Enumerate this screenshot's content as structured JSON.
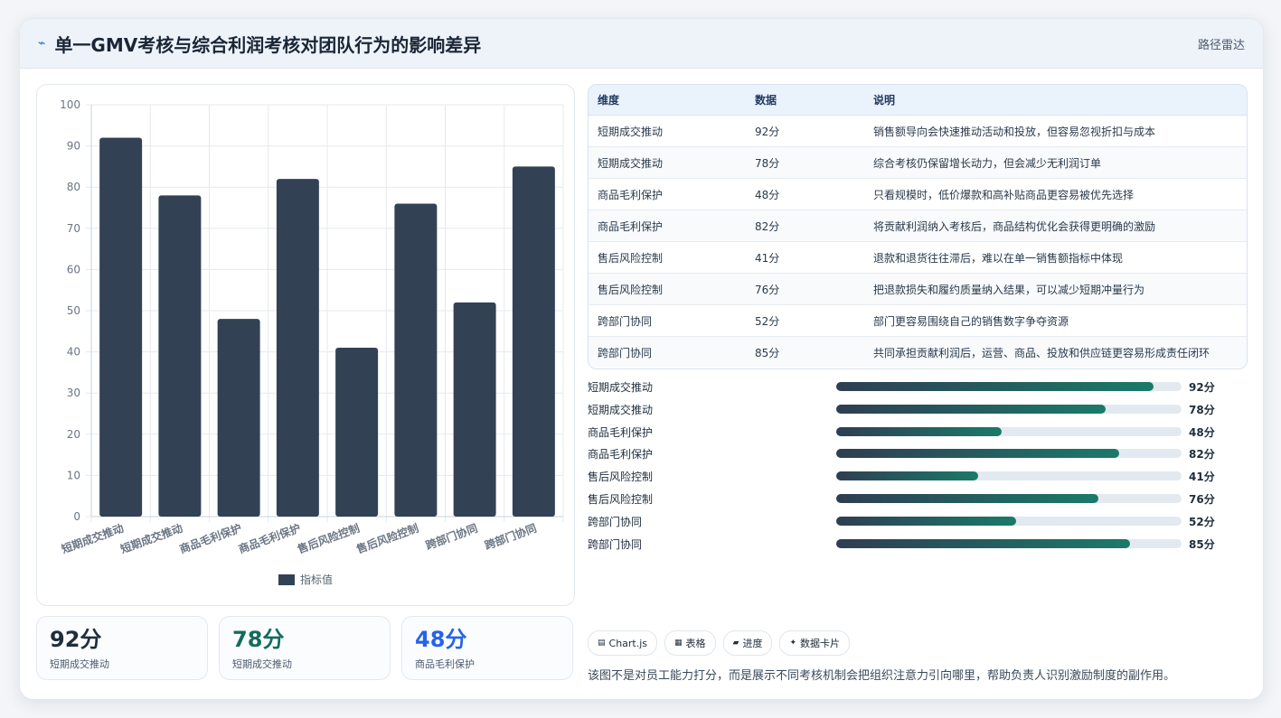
{
  "header": {
    "title": "单一GMV考核与综合利润考核对团队行为的影响差异",
    "tag": "路径雷达",
    "icon": "lightning-icon"
  },
  "chart_data": {
    "type": "bar",
    "categories": [
      "短期成交推动",
      "短期成交推动",
      "商品毛利保护",
      "商品毛利保护",
      "售后风险控制",
      "售后风险控制",
      "跨部门协同",
      "跨部门协同"
    ],
    "series": [
      {
        "name": "指标值",
        "values": [
          92,
          78,
          48,
          82,
          41,
          76,
          52,
          85
        ]
      }
    ],
    "ylim": [
      0,
      100
    ],
    "yticks": [
      0,
      10,
      20,
      30,
      40,
      50,
      60,
      70,
      80,
      90,
      100
    ],
    "grid": true,
    "legend": "bottom",
    "bar_color": "#334155"
  },
  "kpis": [
    {
      "value": "92分",
      "label": "短期成交推动",
      "color": "#1f2d3d"
    },
    {
      "value": "78分",
      "label": "短期成交推动",
      "color": "#146c5c"
    },
    {
      "value": "48分",
      "label": "商品毛利保护",
      "color": "#2563eb"
    }
  ],
  "table": {
    "headers": [
      "维度",
      "数据",
      "说明"
    ],
    "rows": [
      [
        "短期成交推动",
        "92分",
        "销售额导向会快速推动活动和投放，但容易忽视折扣与成本"
      ],
      [
        "短期成交推动",
        "78分",
        "综合考核仍保留增长动力，但会减少无利润订单"
      ],
      [
        "商品毛利保护",
        "48分",
        "只看规模时，低价爆款和高补贴商品更容易被优先选择"
      ],
      [
        "商品毛利保护",
        "82分",
        "将贡献利润纳入考核后，商品结构优化会获得更明确的激励"
      ],
      [
        "售后风险控制",
        "41分",
        "退款和退货往往滞后，难以在单一销售额指标中体现"
      ],
      [
        "售后风险控制",
        "76分",
        "把退款损失和履约质量纳入结果，可以减少短期冲量行为"
      ],
      [
        "跨部门协同",
        "52分",
        "部门更容易围绕自己的销售数字争夺资源"
      ],
      [
        "跨部门协同",
        "85分",
        "共同承担贡献利润后，运营、商品、投放和供应链更容易形成责任闭环"
      ]
    ]
  },
  "progress": [
    {
      "label": "短期成交推动",
      "value": 92,
      "text": "92分"
    },
    {
      "label": "短期成交推动",
      "value": 78,
      "text": "78分"
    },
    {
      "label": "商品毛利保护",
      "value": 48,
      "text": "48分"
    },
    {
      "label": "商品毛利保护",
      "value": 82,
      "text": "82分"
    },
    {
      "label": "售后风险控制",
      "value": 41,
      "text": "41分"
    },
    {
      "label": "售后风险控制",
      "value": 76,
      "text": "76分"
    },
    {
      "label": "跨部门协同",
      "value": 52,
      "text": "52分"
    },
    {
      "label": "跨部门协同",
      "value": 85,
      "text": "85分"
    }
  ],
  "pills": [
    {
      "icon": "▤",
      "label": "Chart.js"
    },
    {
      "icon": "▦",
      "label": "表格"
    },
    {
      "icon": "▰",
      "label": "进度"
    },
    {
      "icon": "✦",
      "label": "数据卡片"
    }
  ],
  "note": "该图不是对员工能力打分，而是展示不同考核机制会把组织注意力引向哪里，帮助负责人识别激励制度的副作用。"
}
